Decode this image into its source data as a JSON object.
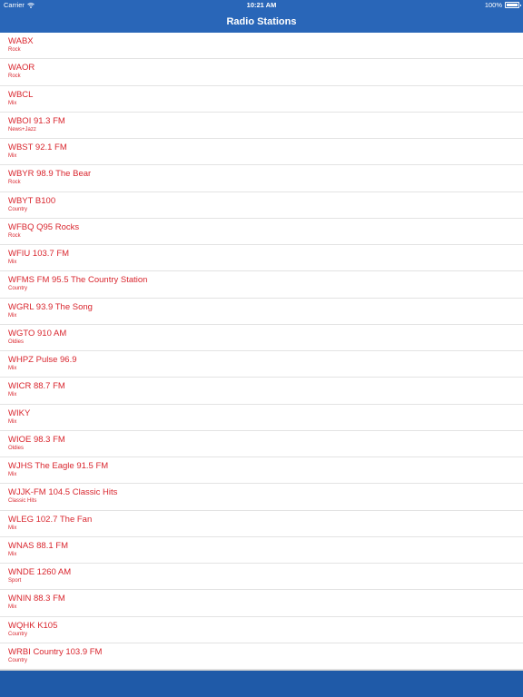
{
  "status": {
    "carrier": "Carrier",
    "time": "10:21 AM",
    "battery": "100%"
  },
  "nav": {
    "title": "Radio Stations"
  },
  "stations": [
    {
      "name": "WABX",
      "genre": "Rock"
    },
    {
      "name": "WAOR",
      "genre": "Rock"
    },
    {
      "name": "WBCL",
      "genre": "Mix"
    },
    {
      "name": "WBOI 91.3 FM",
      "genre": "News+Jazz"
    },
    {
      "name": "WBST 92.1 FM",
      "genre": "Mix"
    },
    {
      "name": "WBYR 98.9 The Bear",
      "genre": "Rock"
    },
    {
      "name": "WBYT B100",
      "genre": "Country"
    },
    {
      "name": "WFBQ Q95 Rocks",
      "genre": "Rock"
    },
    {
      "name": "WFIU 103.7 FM",
      "genre": "Mix"
    },
    {
      "name": "WFMS FM 95.5 The Country Station",
      "genre": "Country"
    },
    {
      "name": "WGRL 93.9 The Song",
      "genre": "Mix"
    },
    {
      "name": "WGTO 910 AM",
      "genre": "Oldies"
    },
    {
      "name": "WHPZ Pulse 96.9",
      "genre": "Mix"
    },
    {
      "name": "WICR 88.7 FM",
      "genre": "Mix"
    },
    {
      "name": "WIKY",
      "genre": "Mix"
    },
    {
      "name": "WIOE 98.3 FM",
      "genre": "Oldies"
    },
    {
      "name": "WJHS The Eagle 91.5 FM",
      "genre": "Mix"
    },
    {
      "name": "WJJK-FM 104.5 Classic Hits",
      "genre": "Classic Hits"
    },
    {
      "name": "WLEG 102.7 The Fan",
      "genre": "Mix"
    },
    {
      "name": "WNAS 88.1 FM",
      "genre": "Mix"
    },
    {
      "name": "WNDE 1260 AM",
      "genre": "Sport"
    },
    {
      "name": "WNIN 88.3 FM",
      "genre": "Mix"
    },
    {
      "name": "WQHK K105",
      "genre": "Country"
    },
    {
      "name": "WRBI Country 103.9 FM",
      "genre": "Country"
    }
  ],
  "colors": {
    "nav": "#2966b8",
    "accent_text": "#d9262e",
    "bottom_bar": "#1f5aa8"
  },
  "icons": {
    "wifi": "wifi-icon",
    "battery": "battery-icon"
  }
}
